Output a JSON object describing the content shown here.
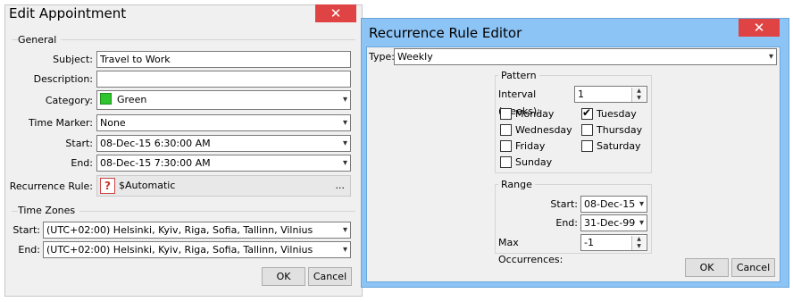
{
  "appointment": {
    "title": "Edit Appointment",
    "general_label": "General",
    "subject_label": "Subject:",
    "subject_value": "Travel to Work",
    "description_label": "Description:",
    "description_value": "",
    "category_label": "Category:",
    "category_value": "Green",
    "category_color": "#2ec52e",
    "time_marker_label": "Time Marker:",
    "time_marker_value": "None",
    "start_label": "Start:",
    "start_value": "08-Dec-15 6:30:00 AM",
    "end_label": "End:",
    "end_value": "08-Dec-15 7:30:00 AM",
    "recurrence_label": "Recurrence Rule:",
    "recurrence_value": "$Automatic",
    "recurrence_icon_glyph": "?",
    "recurrence_more": "...",
    "time_zones_label": "Time Zones",
    "tz_start_label": "Start:",
    "tz_start_value": "(UTC+02:00) Helsinki, Kyiv, Riga, Sofia, Tallinn, Vilnius",
    "tz_end_label": "End:",
    "tz_end_value": "(UTC+02:00) Helsinki, Kyiv, Riga, Sofia, Tallinn, Vilnius",
    "ok_label": "OK",
    "cancel_label": "Cancel",
    "close_glyph": "✕"
  },
  "recurrence_editor": {
    "title": "Recurrence Rule Editor",
    "type_label": "Type:",
    "type_value": "Weekly",
    "pattern_label": "Pattern",
    "interval_label": "Interval (weeks):",
    "interval_value": "1",
    "days": [
      {
        "label": "Monday",
        "checked": false
      },
      {
        "label": "Tuesday",
        "checked": true
      },
      {
        "label": "Wednesday",
        "checked": false
      },
      {
        "label": "Thursday",
        "checked": false
      },
      {
        "label": "Friday",
        "checked": false
      },
      {
        "label": "Saturday",
        "checked": false
      },
      {
        "label": "Sunday",
        "checked": false
      }
    ],
    "range_label": "Range",
    "range_start_label": "Start:",
    "range_start_value": "08-Dec-15",
    "range_end_label": "End:",
    "range_end_value": "31-Dec-99",
    "max_occ_label": "Max Occurrences:",
    "max_occ_value": "-1",
    "ok_label": "OK",
    "cancel_label": "Cancel",
    "close_glyph": "✕",
    "accent_color": "#8dc4f6"
  },
  "glyphs": {
    "dropdown": "▾",
    "spin_up": "▲",
    "spin_down": "▼"
  }
}
